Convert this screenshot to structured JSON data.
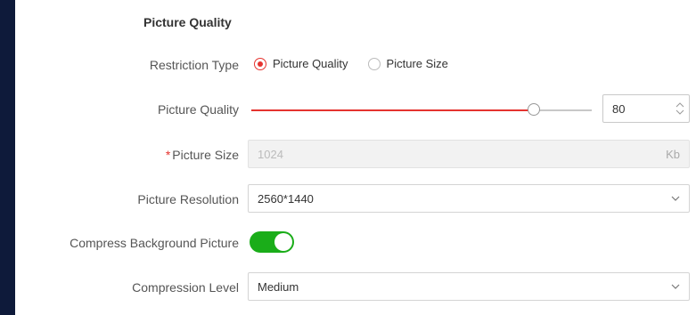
{
  "section": {
    "title": "Picture Quality"
  },
  "restriction": {
    "label": "Restriction Type",
    "options": [
      {
        "label": "Picture Quality",
        "checked": true
      },
      {
        "label": "Picture Size",
        "checked": false
      }
    ]
  },
  "quality": {
    "label": "Picture Quality",
    "value": "80",
    "slider_fraction": 0.83,
    "accent_color": "#e5332f"
  },
  "size": {
    "required_mark": "*",
    "label": "Picture Size",
    "placeholder": "1024",
    "unit": "Kb"
  },
  "resolution": {
    "label": "Picture Resolution",
    "value": "2560*1440"
  },
  "compress": {
    "label": "Compress Background Picture",
    "enabled": true,
    "toggle_color": "#1aad19"
  },
  "compression": {
    "label": "Compression Level",
    "value": "Medium"
  }
}
